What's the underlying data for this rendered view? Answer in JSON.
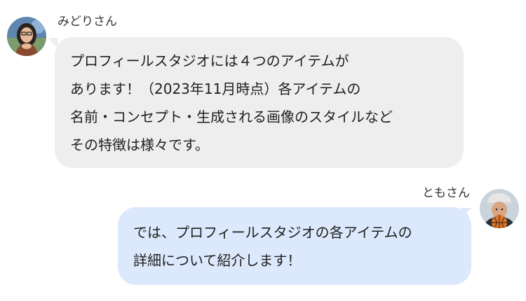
{
  "messages": [
    {
      "sender": "みどりさん",
      "side": "left",
      "bubble_color": "#eeeeee",
      "lines": [
        "プロフィールスタジオには４つのアイテムが",
        "あります！（2023年11月時点）各アイテムの",
        "名前・コンセプト・生成される画像のスタイルなど",
        "その特徴は様々です。"
      ]
    },
    {
      "sender": "ともさん",
      "side": "right",
      "bubble_color": "#dce8fb",
      "lines": [
        "では、プロフィールスタジオの各アイテムの",
        "詳細について紹介します！"
      ]
    }
  ]
}
